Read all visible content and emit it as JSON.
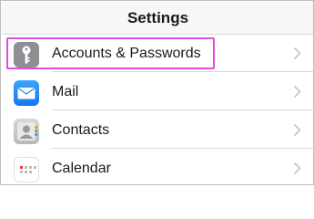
{
  "navbar": {
    "title": "Settings"
  },
  "rows": [
    {
      "label": "Accounts & Passwords",
      "icon": "key-icon"
    },
    {
      "label": "Mail",
      "icon": "mail-icon"
    },
    {
      "label": "Contacts",
      "icon": "contacts-icon"
    },
    {
      "label": "Calendar",
      "icon": "calendar-icon"
    }
  ],
  "colors": {
    "highlight": "#e04ee0",
    "key_icon_bg": "#8e8e93",
    "mail_icon_bg": "#1e8cf5",
    "contacts_icon_bg": "#c8c8c8",
    "calendar_red": "#e8352e",
    "chevron": "#c4c4c8"
  }
}
